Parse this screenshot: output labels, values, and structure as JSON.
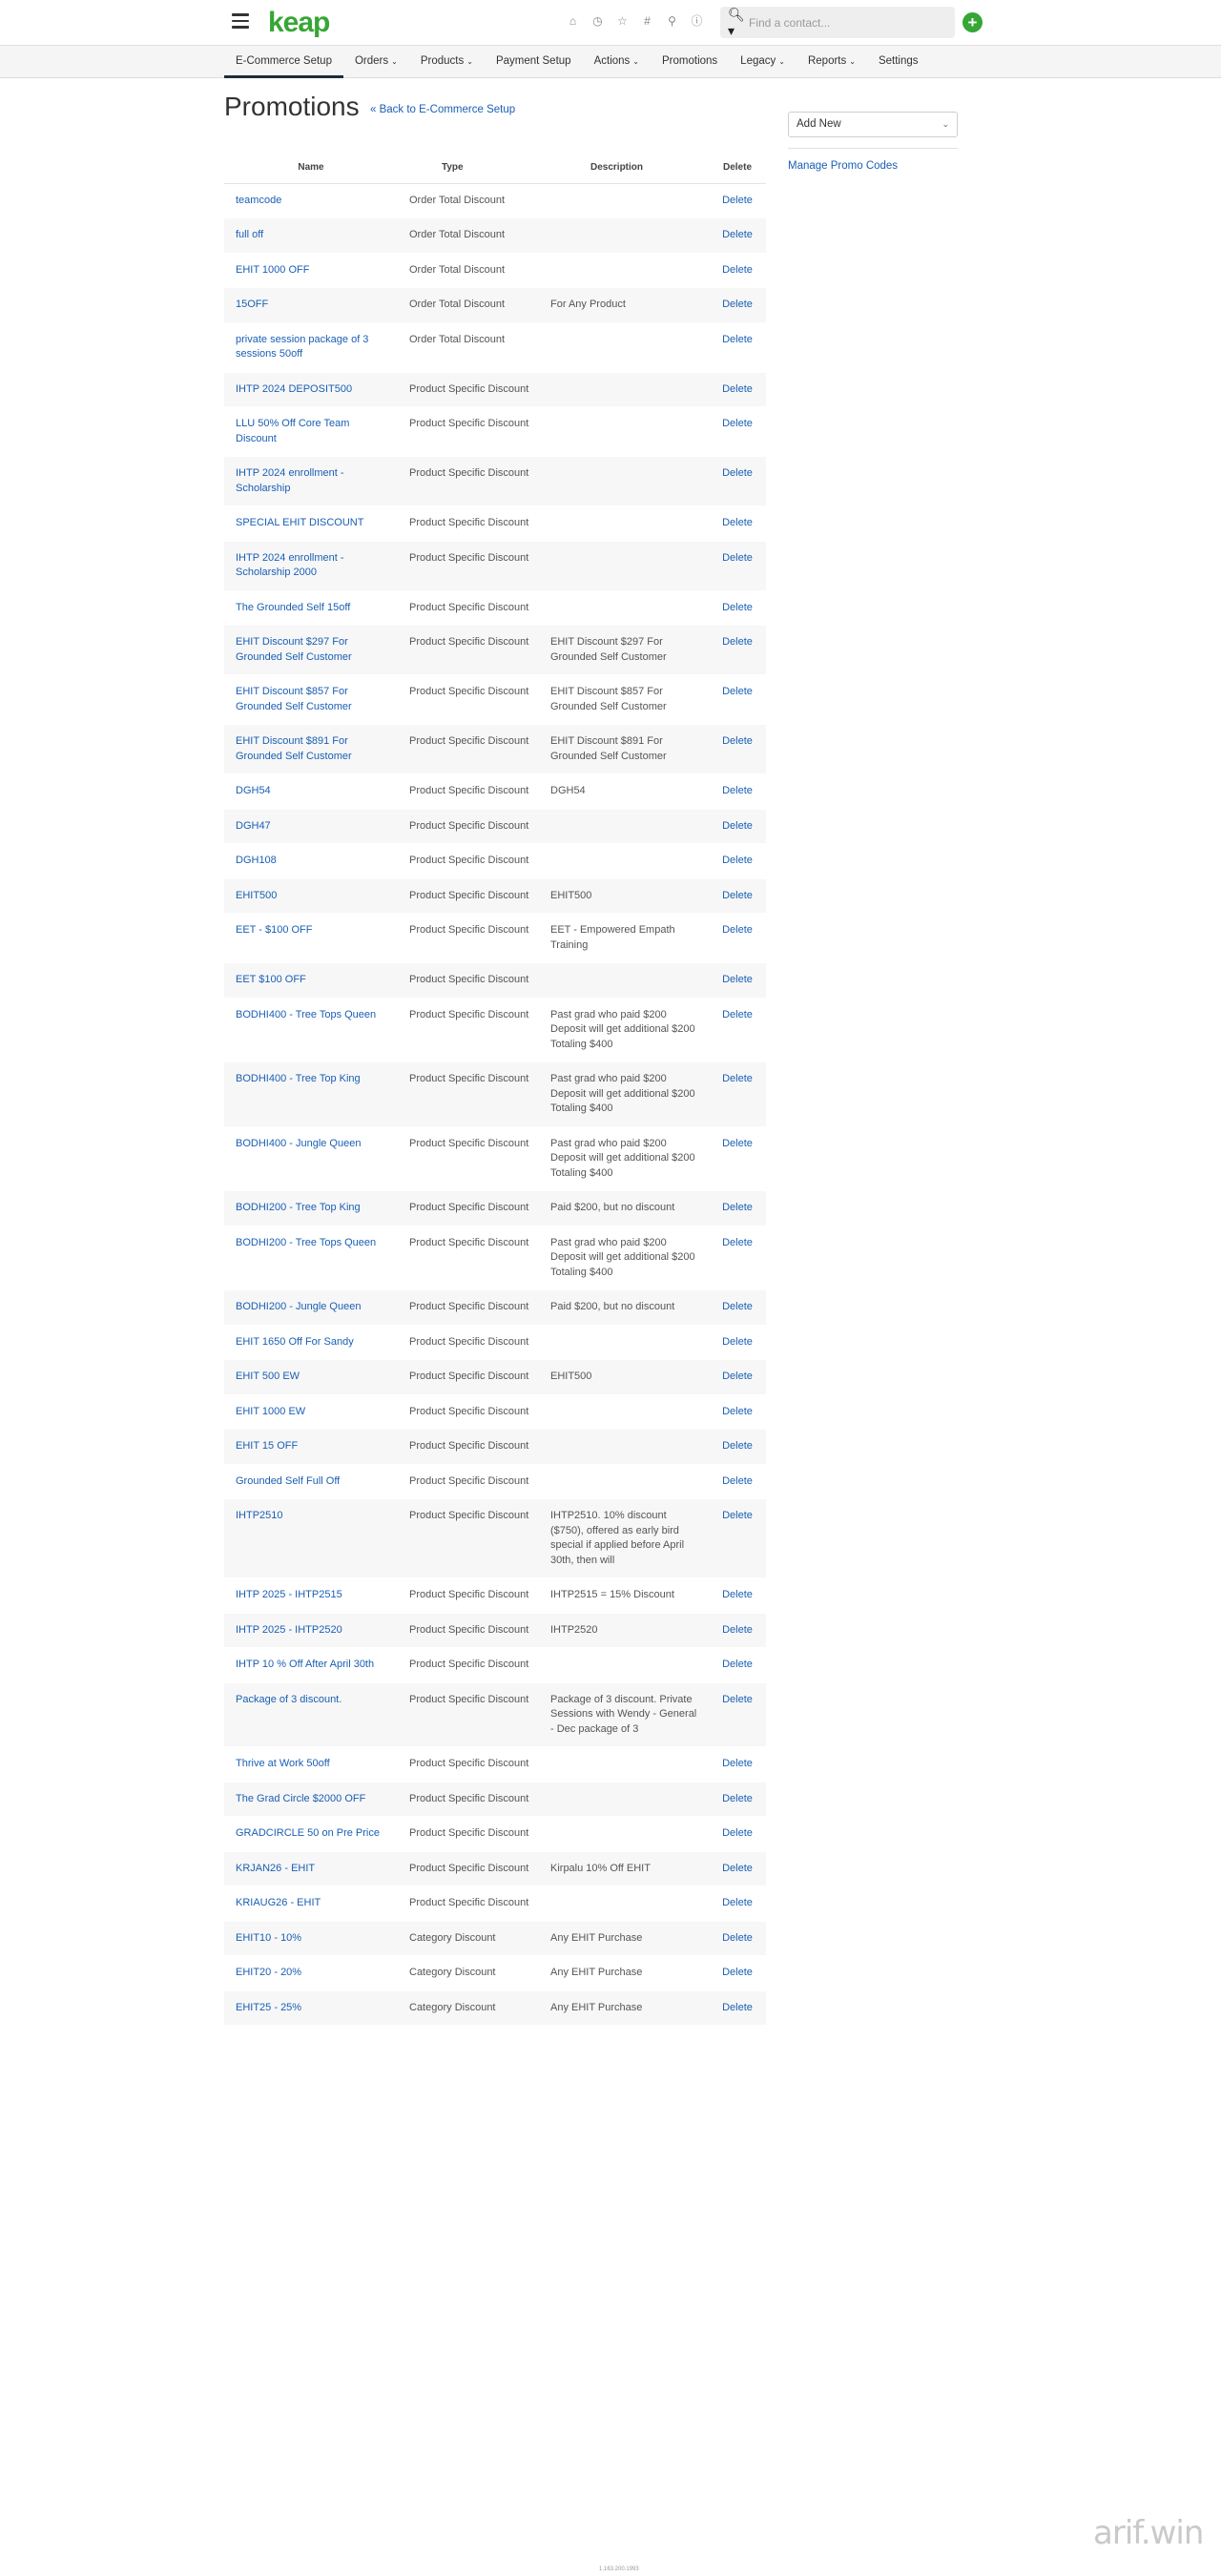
{
  "header": {
    "logo": "keap",
    "search_placeholder": "Find a contact...",
    "icons": [
      "home-icon",
      "history-icon",
      "star-icon",
      "hashtag-icon",
      "user-icon",
      "help-icon"
    ]
  },
  "nav": {
    "items": [
      {
        "label": "E-Commerce Setup",
        "active": true,
        "caret": false
      },
      {
        "label": "Orders",
        "caret": true
      },
      {
        "label": "Products",
        "caret": true
      },
      {
        "label": "Payment Setup",
        "caret": false
      },
      {
        "label": "Actions",
        "caret": true
      },
      {
        "label": "Promotions",
        "caret": false
      },
      {
        "label": "Legacy",
        "caret": true
      },
      {
        "label": "Reports",
        "caret": true
      },
      {
        "label": "Settings",
        "caret": false
      }
    ]
  },
  "page": {
    "title": "Promotions",
    "back_link": "« Back to E-Commerce Setup"
  },
  "sidebar": {
    "add_new": "Add New",
    "manage_link": "Manage Promo Codes"
  },
  "table": {
    "headers": {
      "name": "Name",
      "type": "Type",
      "description": "Description",
      "delete": "Delete"
    },
    "delete_label": "Delete",
    "rows": [
      {
        "name": "teamcode",
        "type": "Order Total Discount",
        "desc": ""
      },
      {
        "name": "full off",
        "type": "Order Total Discount",
        "desc": ""
      },
      {
        "name": "EHIT 1000 OFF",
        "type": "Order Total Discount",
        "desc": ""
      },
      {
        "name": "15OFF",
        "type": "Order Total Discount",
        "desc": "For Any Product"
      },
      {
        "name": "private session package of 3 sessions 50off",
        "type": "Order Total Discount",
        "desc": ""
      },
      {
        "name": "IHTP 2024 DEPOSIT500",
        "type": "Product Specific Discount",
        "desc": ""
      },
      {
        "name": "LLU 50% Off Core Team Discount",
        "type": "Product Specific Discount",
        "desc": ""
      },
      {
        "name": "IHTP 2024 enrollment - Scholarship",
        "type": "Product Specific Discount",
        "desc": ""
      },
      {
        "name": "SPECIAL EHIT DISCOUNT",
        "type": "Product Specific Discount",
        "desc": ""
      },
      {
        "name": "IHTP 2024 enrollment - Scholarship 2000",
        "type": "Product Specific Discount",
        "desc": ""
      },
      {
        "name": "The Grounded Self 15off",
        "type": "Product Specific Discount",
        "desc": ""
      },
      {
        "name": "EHIT Discount $297 For Grounded Self Customer",
        "type": "Product Specific Discount",
        "desc": "EHIT Discount $297 For Grounded Self Customer"
      },
      {
        "name": "EHIT Discount $857 For Grounded Self Customer",
        "type": "Product Specific Discount",
        "desc": "EHIT Discount $857 For Grounded Self Customer"
      },
      {
        "name": "EHIT Discount $891 For Grounded Self Customer",
        "type": "Product Specific Discount",
        "desc": "EHIT Discount $891 For Grounded Self Customer"
      },
      {
        "name": "DGH54",
        "type": "Product Specific Discount",
        "desc": "DGH54"
      },
      {
        "name": "DGH47",
        "type": "Product Specific Discount",
        "desc": ""
      },
      {
        "name": "DGH108",
        "type": "Product Specific Discount",
        "desc": ""
      },
      {
        "name": "EHIT500",
        "type": "Product Specific Discount",
        "desc": "EHIT500"
      },
      {
        "name": "EET - $100 OFF",
        "type": "Product Specific Discount",
        "desc": "EET - Empowered Empath Training"
      },
      {
        "name": "EET $100 OFF",
        "type": "Product Specific Discount",
        "desc": ""
      },
      {
        "name": "BODHI400 - Tree Tops Queen",
        "type": "Product Specific Discount",
        "desc": "Past grad who paid $200 Deposit will get additional $200 Totaling $400"
      },
      {
        "name": "BODHI400 - Tree Top King",
        "type": "Product Specific Discount",
        "desc": "Past grad who paid $200 Deposit will get additional $200 Totaling $400"
      },
      {
        "name": "BODHI400 - Jungle Queen",
        "type": "Product Specific Discount",
        "desc": "Past grad who paid $200 Deposit will get additional $200 Totaling $400"
      },
      {
        "name": "BODHI200 - Tree Top King",
        "type": "Product Specific Discount",
        "desc": "Paid $200, but no discount"
      },
      {
        "name": "BODHI200 - Tree Tops Queen",
        "type": "Product Specific Discount",
        "desc": "Past grad who paid $200 Deposit will get additional $200 Totaling $400"
      },
      {
        "name": "BODHI200 - Jungle Queen",
        "type": "Product Specific Discount",
        "desc": "Paid $200, but no discount"
      },
      {
        "name": "EHIT 1650 Off For Sandy",
        "type": "Product Specific Discount",
        "desc": ""
      },
      {
        "name": "EHIT 500 EW",
        "type": "Product Specific Discount",
        "desc": "EHIT500"
      },
      {
        "name": "EHIT 1000 EW",
        "type": "Product Specific Discount",
        "desc": ""
      },
      {
        "name": "EHIT 15 OFF",
        "type": "Product Specific Discount",
        "desc": ""
      },
      {
        "name": "Grounded Self Full Off",
        "type": "Product Specific Discount",
        "desc": ""
      },
      {
        "name": "IHTP2510",
        "type": "Product Specific Discount",
        "desc": "IHTP2510. 10% discount ($750), offered as early bird special if applied before April 30th, then will"
      },
      {
        "name": "IHTP 2025 - IHTP2515",
        "type": "Product Specific Discount",
        "desc": "IHTP2515 = 15% Discount"
      },
      {
        "name": "IHTP 2025 - IHTP2520",
        "type": "Product Specific Discount",
        "desc": "IHTP2520"
      },
      {
        "name": "IHTP 10 % Off After April 30th",
        "type": "Product Specific Discount",
        "desc": ""
      },
      {
        "name": "Package of 3 discount.",
        "type": "Product Specific Discount",
        "desc": "Package of 3 discount. Private Sessions with Wendy - General - Dec package of 3"
      },
      {
        "name": "Thrive at Work 50off",
        "type": "Product Specific Discount",
        "desc": ""
      },
      {
        "name": "The Grad Circle $2000 OFF",
        "type": "Product Specific Discount",
        "desc": ""
      },
      {
        "name": "GRADCIRCLE 50 on Pre Price",
        "type": "Product Specific Discount",
        "desc": ""
      },
      {
        "name": "KRJAN26 - EHIT",
        "type": "Product Specific Discount",
        "desc": "Kirpalu 10% Off EHIT"
      },
      {
        "name": "KRIAUG26 - EHIT",
        "type": "Product Specific Discount",
        "desc": ""
      },
      {
        "name": "EHIT10 - 10%",
        "type": "Category Discount",
        "desc": "Any EHIT Purchase"
      },
      {
        "name": "EHIT20 - 20%",
        "type": "Category Discount",
        "desc": "Any EHIT Purchase"
      },
      {
        "name": "EHIT25 - 25%",
        "type": "Category Discount",
        "desc": "Any EHIT Purchase"
      }
    ]
  },
  "footer": {
    "version": "1.163.200.1993"
  },
  "watermark": "arif.win",
  "colors": {
    "brand_green": "#36a635",
    "link_blue": "#1a5fb4"
  }
}
